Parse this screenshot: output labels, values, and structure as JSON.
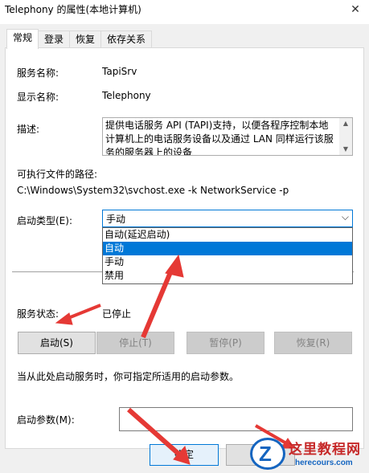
{
  "window": {
    "title": "Telephony 的属性(本地计算机)",
    "close_glyph": "✕"
  },
  "tabs": [
    {
      "label": "常规",
      "active": true
    },
    {
      "label": "登录"
    },
    {
      "label": "恢复"
    },
    {
      "label": "依存关系"
    }
  ],
  "general": {
    "service_name_label": "服务名称:",
    "service_name_value": "TapiSrv",
    "display_name_label": "显示名称:",
    "display_name_value": "Telephony",
    "description_label": "描述:",
    "description_value": "提供电话服务 API (TAPI)支持，以便各程序控制本地计算机上的电话服务设备以及通过 LAN 同样运行该服务的服务器上的设备",
    "exe_path_label": "可执行文件的路径:",
    "exe_path_value": "C:\\Windows\\System32\\svchost.exe -k NetworkService -p",
    "startup_type_label": "启动类型(E):",
    "startup_type_value": "手动",
    "startup_options": [
      "自动(延迟启动)",
      "自动",
      "手动",
      "禁用"
    ],
    "startup_highlighted": "自动",
    "status_label": "服务状态:",
    "status_value": "已停止",
    "buttons": {
      "start": "启动(S)",
      "stop": "停止(T)",
      "pause": "暂停(P)",
      "resume": "恢复(R)"
    },
    "hint": "当从此处启动服务时，你可指定所适用的启动参数。",
    "params_label": "启动参数(M):",
    "params_value": ""
  },
  "footer": {
    "ok": "确定"
  },
  "watermark": {
    "cn": "这里教程网",
    "en": "herecours.com",
    "logo_letter": "Z"
  },
  "colors": {
    "accent": "#0078d7",
    "arrow": "#e53935",
    "dialog_bg": "#f0f0f0"
  }
}
